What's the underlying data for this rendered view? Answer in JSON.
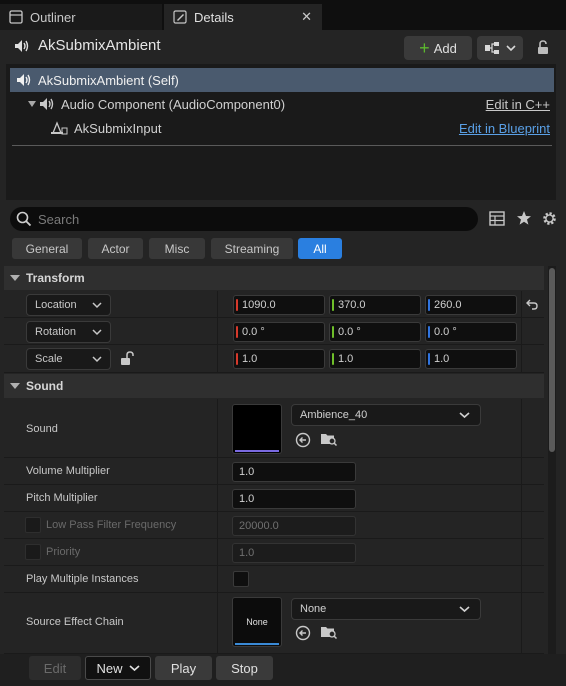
{
  "tabs": {
    "outliner": "Outliner",
    "details": "Details",
    "close": "✕"
  },
  "header": {
    "actor_name": "AkSubmixAmbient",
    "add_label": "Add"
  },
  "tree": {
    "self": "AkSubmixAmbient (Self)",
    "audio_component": "Audio Component (AudioComponent0)",
    "audio_link": "Edit in C++",
    "submix_input": "AkSubmixInput",
    "submix_link": "Edit in Blueprint"
  },
  "search": {
    "placeholder": "Search"
  },
  "filters": [
    "General",
    "Actor",
    "Misc",
    "Streaming",
    "All"
  ],
  "transform": {
    "title": "Transform",
    "location": {
      "label": "Location",
      "x": "1090.0",
      "y": "370.0",
      "z": "260.0"
    },
    "rotation": {
      "label": "Rotation",
      "x": "0.0 °",
      "y": "0.0 °",
      "z": "0.0 °"
    },
    "scale": {
      "label": "Scale",
      "x": "1.0",
      "y": "1.0",
      "z": "1.0"
    }
  },
  "sound": {
    "title": "Sound",
    "sound_label": "Sound",
    "sound_asset": "Ambience_40",
    "volume_label": "Volume Multiplier",
    "volume_value": "1.0",
    "pitch_label": "Pitch Multiplier",
    "pitch_value": "1.0",
    "lowpass_label": "Low Pass Filter Frequency",
    "lowpass_value": "20000.0",
    "priority_label": "Priority",
    "priority_value": "1.0",
    "play_multiple_label": "Play Multiple Instances",
    "source_effect_label": "Source Effect Chain",
    "source_effect_thumb": "None",
    "source_effect_asset": "None"
  },
  "bottom": {
    "edit": "Edit",
    "new": "New",
    "play": "Play",
    "stop": "Stop"
  },
  "colors": {
    "x_axis": "#d6392b",
    "y_axis": "#6fbf2a",
    "z_axis": "#2f74e0",
    "accent": "#2a7fe0",
    "selection": "#4a5a6e"
  },
  "icons": {
    "tab_outliner": "outliner-icon",
    "tab_details": "pencil-icon",
    "actor": "speaker-icon",
    "lock": "lock-icon",
    "search": "search-icon",
    "table": "table-icon",
    "star": "star-icon",
    "gear": "gear-icon",
    "reset": "reset-arrow-icon",
    "browse": "folder-search-icon",
    "use": "use-selected-icon"
  }
}
